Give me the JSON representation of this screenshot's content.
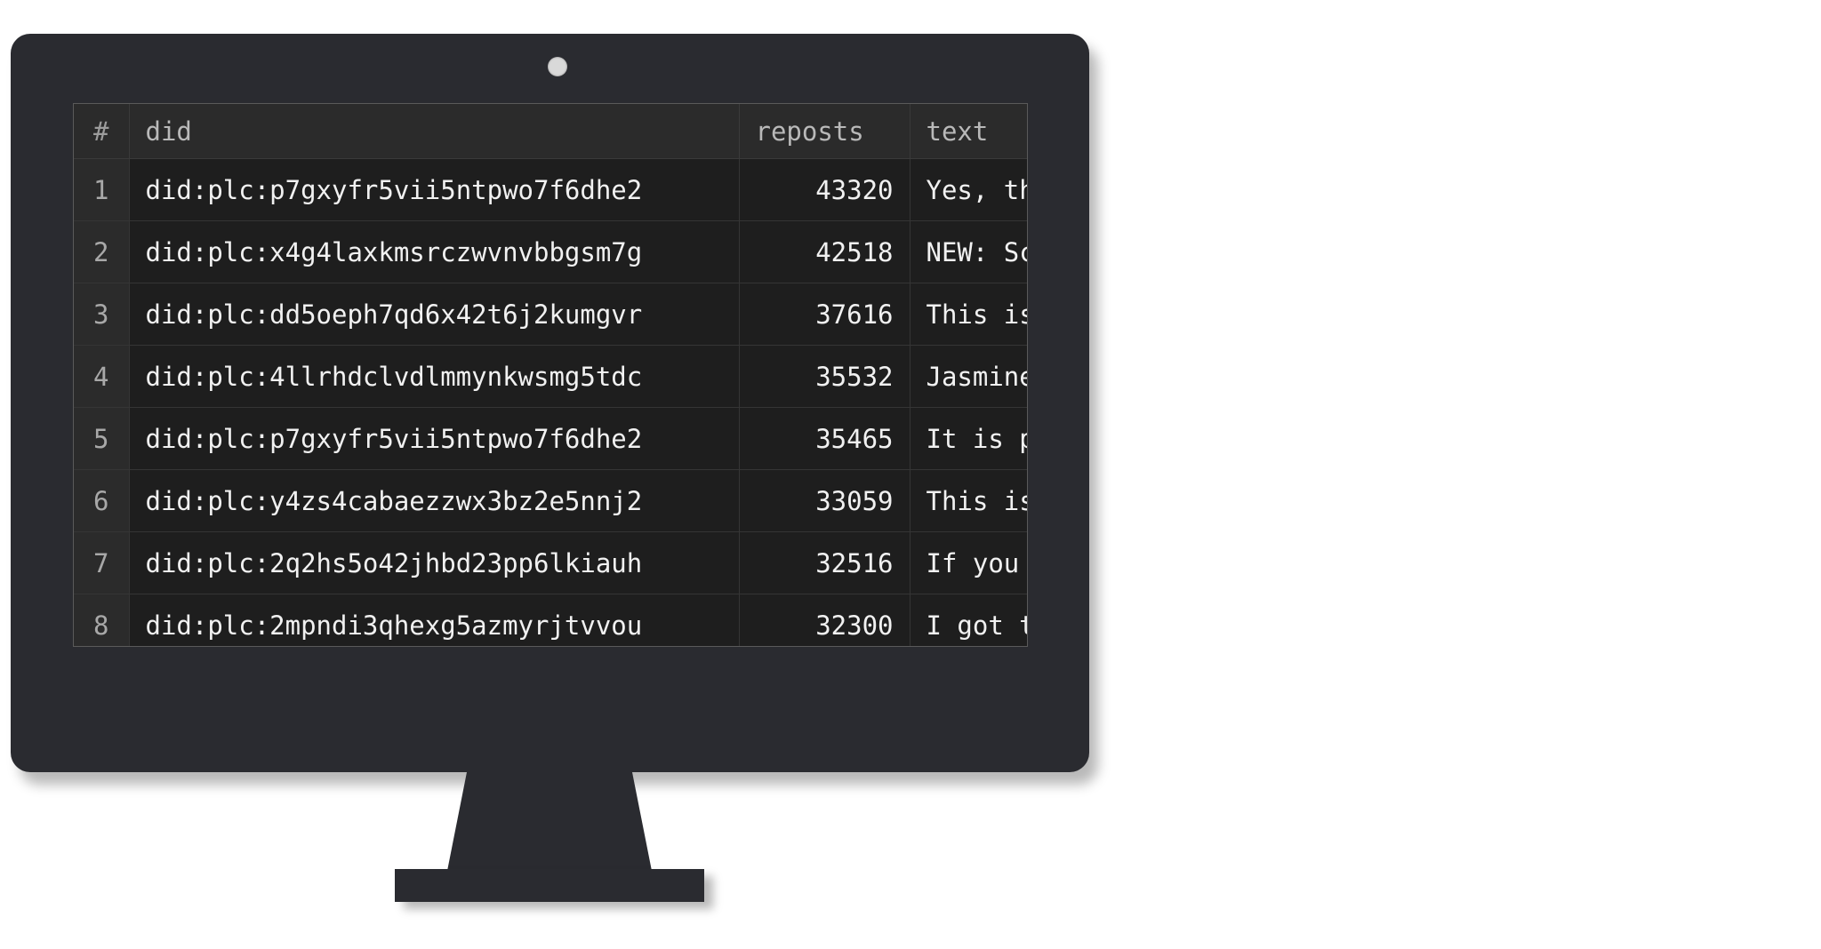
{
  "table": {
    "columns": [
      "#",
      "did",
      "reposts",
      "text"
    ],
    "rows": [
      {
        "num": "1",
        "did": "did:plc:p7gxyfr5vii5ntpwo7f6dhe2",
        "reposts": "43320",
        "text": "Yes, th"
      },
      {
        "num": "2",
        "did": "did:plc:x4g4laxkmsrczwvnvbbgsm7g",
        "reposts": "42518",
        "text": "NEW: Sc"
      },
      {
        "num": "3",
        "did": "did:plc:dd5oeph7qd6x42t6j2kumgvr",
        "reposts": "37616",
        "text": "This is"
      },
      {
        "num": "4",
        "did": "did:plc:4llrhdclvdlmmynkwsmg5tdc",
        "reposts": "35532",
        "text": "Jasmine"
      },
      {
        "num": "5",
        "did": "did:plc:p7gxyfr5vii5ntpwo7f6dhe2",
        "reposts": "35465",
        "text": "It is p"
      },
      {
        "num": "6",
        "did": "did:plc:y4zs4cabaezzwx3bz2e5nnj2",
        "reposts": "33059",
        "text": "This is"
      },
      {
        "num": "7",
        "did": "did:plc:2q2hs5o42jhbd23pp6lkiauh",
        "reposts": "32516",
        "text": "If you"
      },
      {
        "num": "8",
        "did": "did:plc:2mpndi3qhexg5azmyrjtvvou",
        "reposts": "32300",
        "text": "I got t"
      }
    ]
  },
  "colors": {
    "bezel": "#2a2b30",
    "screen": "#1e1e1e",
    "header": "#2b2b2b",
    "text": "#f1f1f1"
  }
}
